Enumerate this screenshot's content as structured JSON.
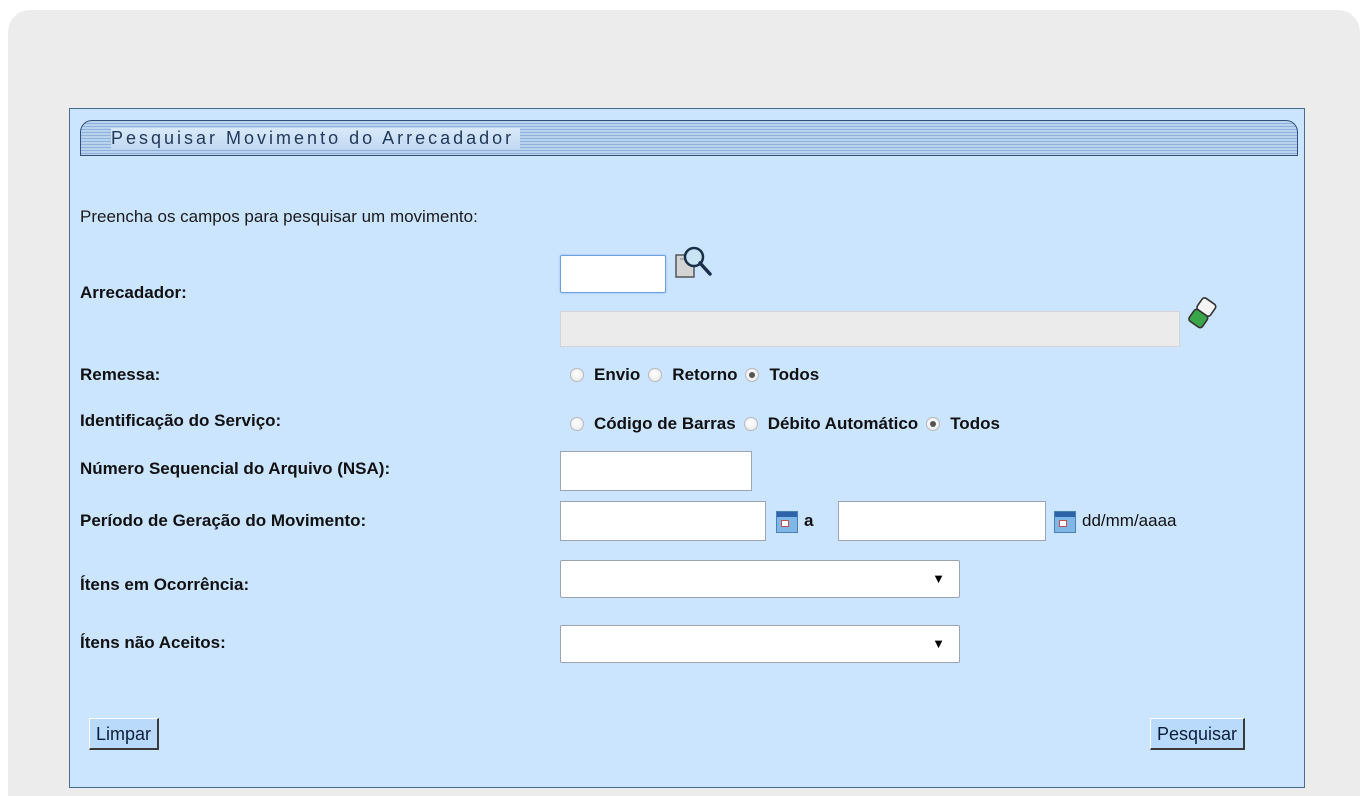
{
  "panel": {
    "title": "Pesquisar Movimento do Arrecadador",
    "intro": "Preencha os campos para pesquisar um movimento:"
  },
  "fields": {
    "arrecadador": {
      "label": "Arrecadador:",
      "value": "",
      "description": ""
    },
    "remessa": {
      "label": "Remessa:",
      "options": [
        "Envio",
        "Retorno",
        "Todos"
      ],
      "selected": "Todos"
    },
    "identificacao": {
      "label": "Identificação do Serviço:",
      "options": [
        "Código de Barras",
        "Débito Automático",
        "Todos"
      ],
      "selected": "Todos"
    },
    "nsa": {
      "label": "Número Sequencial do Arquivo (NSA):",
      "value": ""
    },
    "periodo": {
      "label": "Período de Geração do Movimento:",
      "start": "",
      "separator": "a",
      "end": "",
      "format_hint": "dd/mm/aaaa"
    },
    "itens_ocorrencia": {
      "label": "Ítens em Ocorrência:",
      "selected": ""
    },
    "itens_nao_aceitos": {
      "label": "Ítens não Aceitos:",
      "selected": ""
    }
  },
  "buttons": {
    "limpar": "Limpar",
    "pesquisar": "Pesquisar"
  },
  "icons": {
    "lookup": "magnifier-search-icon",
    "eraser": "eraser-icon",
    "calendar": "calendar-icon",
    "dropdown": "▼"
  },
  "colors": {
    "panel_bg": "#cce5ff",
    "page_bg": "#ececec",
    "button_bg": "#b9dafa"
  }
}
